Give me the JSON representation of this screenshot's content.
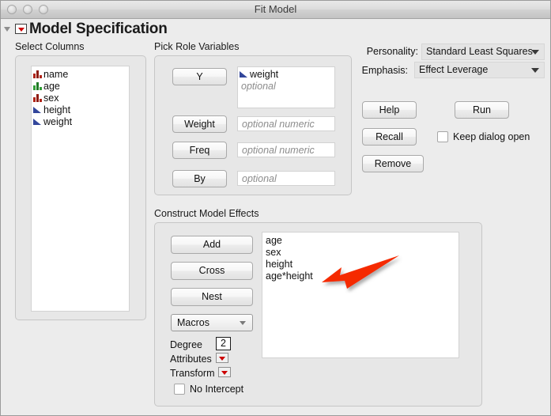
{
  "window": {
    "title": "Fit Model",
    "traffic_lights": [
      "close-button",
      "minimize-button",
      "zoom-button"
    ]
  },
  "header": {
    "title": "Model Specification",
    "red_triangle_menu": "red-triangle-menu-icon",
    "disclosure": "disclosure-triangle-icon"
  },
  "select_columns": {
    "label": "Select Columns",
    "columns": [
      {
        "name": "name",
        "type_icon": "nominal-red-bars-icon"
      },
      {
        "name": "age",
        "type_icon": "ordinal-green-bars-icon"
      },
      {
        "name": "sex",
        "type_icon": "nominal-red-bars-icon"
      },
      {
        "name": "height",
        "type_icon": "continuous-blue-triangle-icon"
      },
      {
        "name": "weight",
        "type_icon": "continuous-blue-triangle-icon"
      }
    ]
  },
  "pick_role_variables": {
    "label": "Pick Role Variables",
    "roles": [
      {
        "button": "Y",
        "value": "weight",
        "value_icon": "continuous-blue-triangle-icon",
        "placeholder": "optional"
      },
      {
        "button": "Weight",
        "value": "",
        "placeholder": "optional numeric"
      },
      {
        "button": "Freq",
        "value": "",
        "placeholder": "optional numeric"
      },
      {
        "button": "By",
        "value": "",
        "placeholder": "optional"
      }
    ]
  },
  "options": {
    "personality_label": "Personality:",
    "personality_value": "Standard Least Squares",
    "emphasis_label": "Emphasis:",
    "emphasis_value": "Effect Leverage",
    "help_label": "Help",
    "run_label": "Run",
    "recall_label": "Recall",
    "remove_label": "Remove",
    "keep_dialog_open_label": "Keep dialog open",
    "keep_dialog_open_checked": false
  },
  "construct_model_effects": {
    "label": "Construct Model Effects",
    "add_label": "Add",
    "cross_label": "Cross",
    "nest_label": "Nest",
    "macros_label": "Macros",
    "degree_label": "Degree",
    "degree_value": "2",
    "attributes_label": "Attributes",
    "transform_label": "Transform",
    "no_intercept_label": "No Intercept",
    "no_intercept_checked": false,
    "effects": [
      "age",
      "sex",
      "height",
      "age*height"
    ]
  },
  "annotation": {
    "arrow": "red-arrow-annotation",
    "color": "#f52b00",
    "points_to": "age*height"
  },
  "colors": {
    "window_bg": "#ececec",
    "panel_bg": "#e7e7e7",
    "listbox_bg": "#ffffff",
    "nominal_icon": "#b02418",
    "ordinal_icon": "#2f9e35",
    "continuous_icon": "#32469b",
    "red_triangle": "#cc0000",
    "annotation_red": "#f52b00"
  }
}
